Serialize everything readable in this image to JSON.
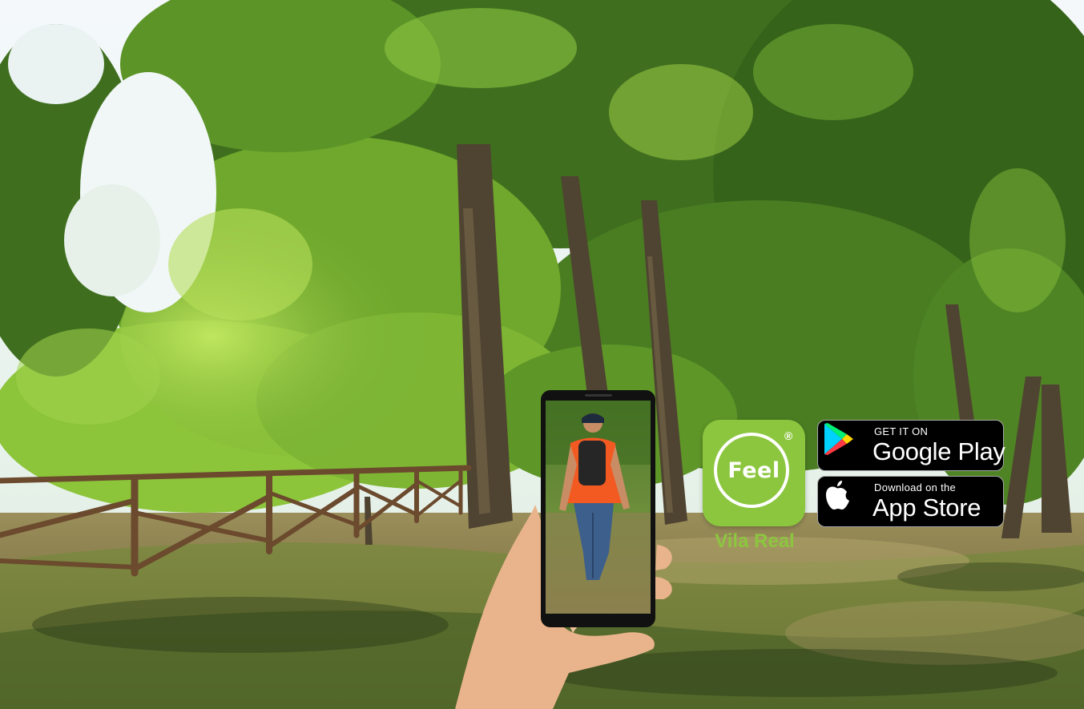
{
  "scene": {
    "colors": {
      "sky": "#eef5f8",
      "foliage_dark": "#3d6a1f",
      "foliage_mid": "#6aa32c",
      "foliage_light": "#a8d94a",
      "trunk": "#5a4a34",
      "ground": "#8b7a4e",
      "grass": "#6e8f34",
      "fence": "#6b4a2e"
    }
  },
  "feel_logo": {
    "word": "Feel",
    "registered": "®",
    "city": "Vila Real",
    "color": "#8cc63f"
  },
  "google_play": {
    "small_text": "GET IT ON",
    "big_text": "Google Play",
    "icon": "google-play-icon"
  },
  "app_store": {
    "small_text": "Download on the",
    "big_text": "App Store",
    "icon": "apple-icon"
  }
}
